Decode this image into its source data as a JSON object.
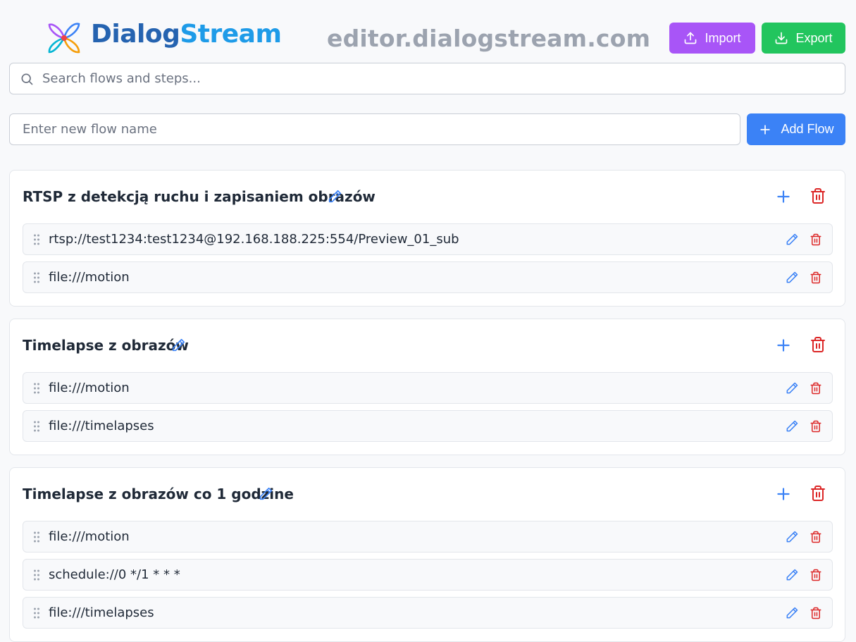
{
  "header": {
    "brand_part1": "Dialog",
    "brand_part2": "Stream",
    "domain": "editor.dialogstream.com",
    "import_label": "Import",
    "export_label": "Export"
  },
  "search": {
    "placeholder": "Search flows and steps..."
  },
  "new_flow": {
    "placeholder": "Enter new flow name",
    "add_label": "Add Flow"
  },
  "flows": [
    {
      "title": "RTSP z detekcją ruchu i zapisaniem obrazów",
      "steps": [
        "rtsp://test1234:test1234@192.168.188.225:554/Preview_01_sub",
        "file:///motion"
      ]
    },
    {
      "title": "Timelapse z obrazów",
      "steps": [
        "file:///motion",
        "file:///timelapses"
      ]
    },
    {
      "title": "Timelapse z obrazów co 1 godzine",
      "steps": [
        "file:///motion",
        "schedule://0 */1 * * *",
        "file:///timelapses"
      ]
    }
  ],
  "colors": {
    "import": "#a855f7",
    "export": "#22c55e",
    "primary": "#3b82f6",
    "danger": "#dc2626"
  }
}
